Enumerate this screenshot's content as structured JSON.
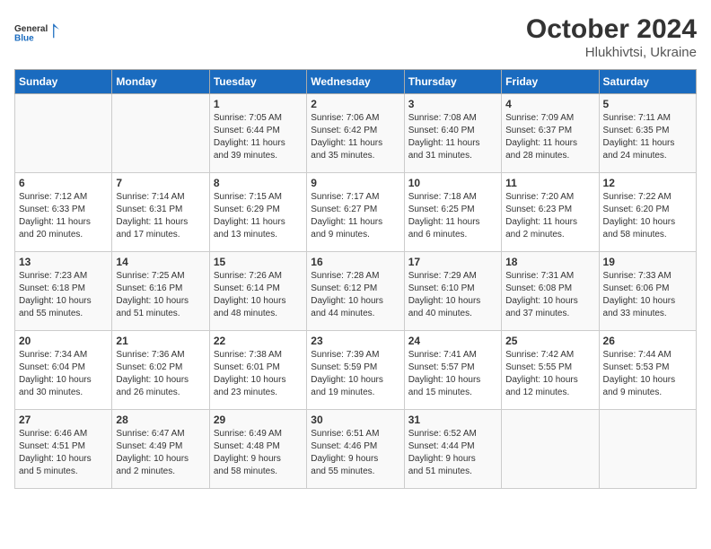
{
  "header": {
    "logo_line1": "General",
    "logo_line2": "Blue",
    "month_title": "October 2024",
    "location": "Hlukhivtsi, Ukraine"
  },
  "weekdays": [
    "Sunday",
    "Monday",
    "Tuesday",
    "Wednesday",
    "Thursday",
    "Friday",
    "Saturday"
  ],
  "weeks": [
    [
      {
        "day": "",
        "info": ""
      },
      {
        "day": "",
        "info": ""
      },
      {
        "day": "1",
        "info": "Sunrise: 7:05 AM\nSunset: 6:44 PM\nDaylight: 11 hours\nand 39 minutes."
      },
      {
        "day": "2",
        "info": "Sunrise: 7:06 AM\nSunset: 6:42 PM\nDaylight: 11 hours\nand 35 minutes."
      },
      {
        "day": "3",
        "info": "Sunrise: 7:08 AM\nSunset: 6:40 PM\nDaylight: 11 hours\nand 31 minutes."
      },
      {
        "day": "4",
        "info": "Sunrise: 7:09 AM\nSunset: 6:37 PM\nDaylight: 11 hours\nand 28 minutes."
      },
      {
        "day": "5",
        "info": "Sunrise: 7:11 AM\nSunset: 6:35 PM\nDaylight: 11 hours\nand 24 minutes."
      }
    ],
    [
      {
        "day": "6",
        "info": "Sunrise: 7:12 AM\nSunset: 6:33 PM\nDaylight: 11 hours\nand 20 minutes."
      },
      {
        "day": "7",
        "info": "Sunrise: 7:14 AM\nSunset: 6:31 PM\nDaylight: 11 hours\nand 17 minutes."
      },
      {
        "day": "8",
        "info": "Sunrise: 7:15 AM\nSunset: 6:29 PM\nDaylight: 11 hours\nand 13 minutes."
      },
      {
        "day": "9",
        "info": "Sunrise: 7:17 AM\nSunset: 6:27 PM\nDaylight: 11 hours\nand 9 minutes."
      },
      {
        "day": "10",
        "info": "Sunrise: 7:18 AM\nSunset: 6:25 PM\nDaylight: 11 hours\nand 6 minutes."
      },
      {
        "day": "11",
        "info": "Sunrise: 7:20 AM\nSunset: 6:23 PM\nDaylight: 11 hours\nand 2 minutes."
      },
      {
        "day": "12",
        "info": "Sunrise: 7:22 AM\nSunset: 6:20 PM\nDaylight: 10 hours\nand 58 minutes."
      }
    ],
    [
      {
        "day": "13",
        "info": "Sunrise: 7:23 AM\nSunset: 6:18 PM\nDaylight: 10 hours\nand 55 minutes."
      },
      {
        "day": "14",
        "info": "Sunrise: 7:25 AM\nSunset: 6:16 PM\nDaylight: 10 hours\nand 51 minutes."
      },
      {
        "day": "15",
        "info": "Sunrise: 7:26 AM\nSunset: 6:14 PM\nDaylight: 10 hours\nand 48 minutes."
      },
      {
        "day": "16",
        "info": "Sunrise: 7:28 AM\nSunset: 6:12 PM\nDaylight: 10 hours\nand 44 minutes."
      },
      {
        "day": "17",
        "info": "Sunrise: 7:29 AM\nSunset: 6:10 PM\nDaylight: 10 hours\nand 40 minutes."
      },
      {
        "day": "18",
        "info": "Sunrise: 7:31 AM\nSunset: 6:08 PM\nDaylight: 10 hours\nand 37 minutes."
      },
      {
        "day": "19",
        "info": "Sunrise: 7:33 AM\nSunset: 6:06 PM\nDaylight: 10 hours\nand 33 minutes."
      }
    ],
    [
      {
        "day": "20",
        "info": "Sunrise: 7:34 AM\nSunset: 6:04 PM\nDaylight: 10 hours\nand 30 minutes."
      },
      {
        "day": "21",
        "info": "Sunrise: 7:36 AM\nSunset: 6:02 PM\nDaylight: 10 hours\nand 26 minutes."
      },
      {
        "day": "22",
        "info": "Sunrise: 7:38 AM\nSunset: 6:01 PM\nDaylight: 10 hours\nand 23 minutes."
      },
      {
        "day": "23",
        "info": "Sunrise: 7:39 AM\nSunset: 5:59 PM\nDaylight: 10 hours\nand 19 minutes."
      },
      {
        "day": "24",
        "info": "Sunrise: 7:41 AM\nSunset: 5:57 PM\nDaylight: 10 hours\nand 15 minutes."
      },
      {
        "day": "25",
        "info": "Sunrise: 7:42 AM\nSunset: 5:55 PM\nDaylight: 10 hours\nand 12 minutes."
      },
      {
        "day": "26",
        "info": "Sunrise: 7:44 AM\nSunset: 5:53 PM\nDaylight: 10 hours\nand 9 minutes."
      }
    ],
    [
      {
        "day": "27",
        "info": "Sunrise: 6:46 AM\nSunset: 4:51 PM\nDaylight: 10 hours\nand 5 minutes."
      },
      {
        "day": "28",
        "info": "Sunrise: 6:47 AM\nSunset: 4:49 PM\nDaylight: 10 hours\nand 2 minutes."
      },
      {
        "day": "29",
        "info": "Sunrise: 6:49 AM\nSunset: 4:48 PM\nDaylight: 9 hours\nand 58 minutes."
      },
      {
        "day": "30",
        "info": "Sunrise: 6:51 AM\nSunset: 4:46 PM\nDaylight: 9 hours\nand 55 minutes."
      },
      {
        "day": "31",
        "info": "Sunrise: 6:52 AM\nSunset: 4:44 PM\nDaylight: 9 hours\nand 51 minutes."
      },
      {
        "day": "",
        "info": ""
      },
      {
        "day": "",
        "info": ""
      }
    ]
  ]
}
